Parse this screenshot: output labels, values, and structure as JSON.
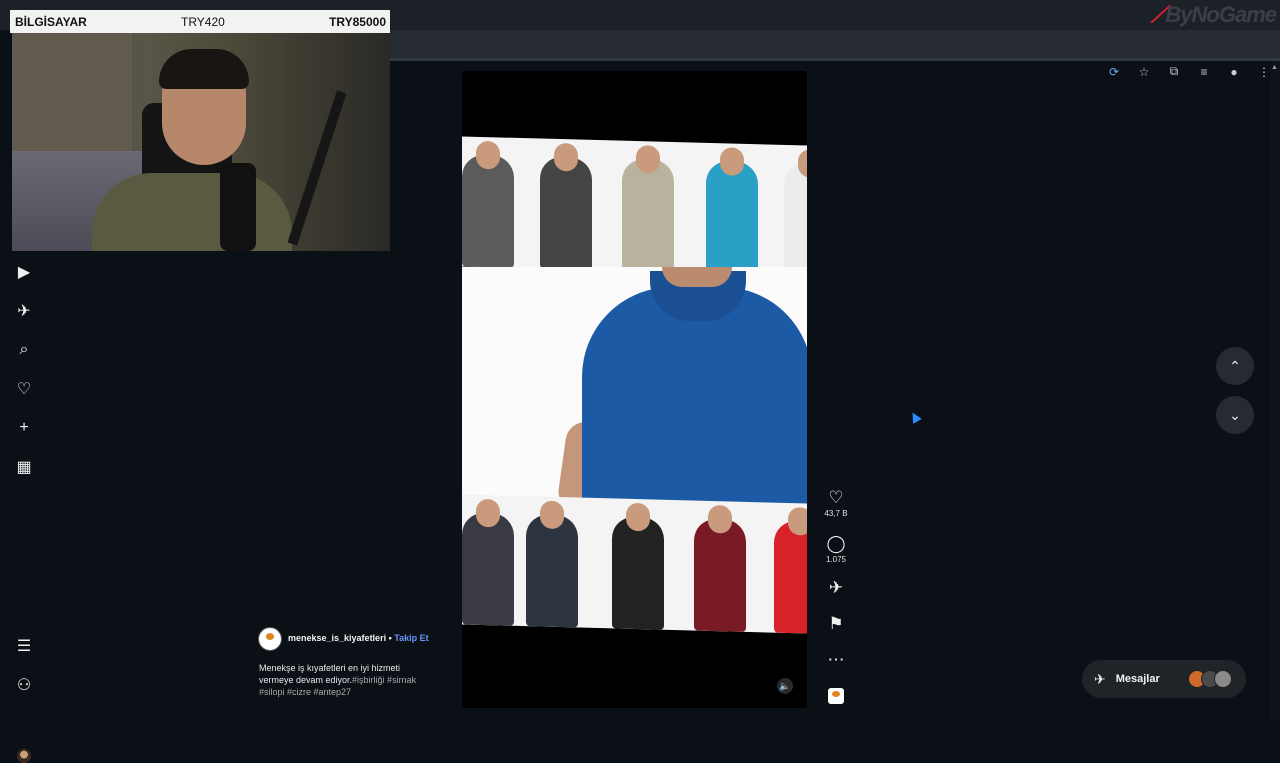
{
  "overlay": {
    "category": "BİLGİSAYAR",
    "amount_small": "TRY420",
    "amount_total": "TRY85000"
  },
  "brand": {
    "logo_text": "ByNoGame"
  },
  "left_nav": {
    "items": [
      {
        "name": "reels",
        "icon": "▶"
      },
      {
        "name": "messages",
        "icon": "✈"
      },
      {
        "name": "search",
        "icon": "⌕"
      },
      {
        "name": "notifications",
        "icon": "♡"
      },
      {
        "name": "create",
        "icon": "+"
      },
      {
        "name": "dashboard",
        "icon": "▦"
      }
    ],
    "more_icon": "☰",
    "meta_icon": "⚇"
  },
  "reel": {
    "likes": "43,7 B",
    "comments": "1.075",
    "sound_icon": "🔈",
    "owner": "menekse_is_kiyafetleri",
    "separator": "•",
    "follow_label": "Takip Et",
    "caption_line1": "Menekşe iş kıyafetleri en iyi hizmeti",
    "caption_line2": "vermeye devam ediyor.",
    "caption_tags_inline": "#işbirliği #sirnak",
    "caption_tags_line3": "#silopi #cizre #antep27",
    "colors": {
      "top_strip": [
        "#5b5b5b",
        "#444444",
        "#b9b29e",
        "#2aa0c6",
        "#ececec"
      ],
      "bottom_strip": [
        "#3a3a44",
        "#2c3440",
        "#222222",
        "#7a1a24",
        "#d7222a"
      ],
      "polo_main": "#1c5aa6"
    }
  },
  "actions": {
    "like_icon": "♡",
    "comment_icon": "◯",
    "share_icon": "✈",
    "save_icon": "⚑",
    "more_icon": "⋯"
  },
  "nav": {
    "up_icon": "⌃",
    "down_icon": "⌄"
  },
  "messages": {
    "label": "Mesajlar",
    "icon": "✈"
  }
}
